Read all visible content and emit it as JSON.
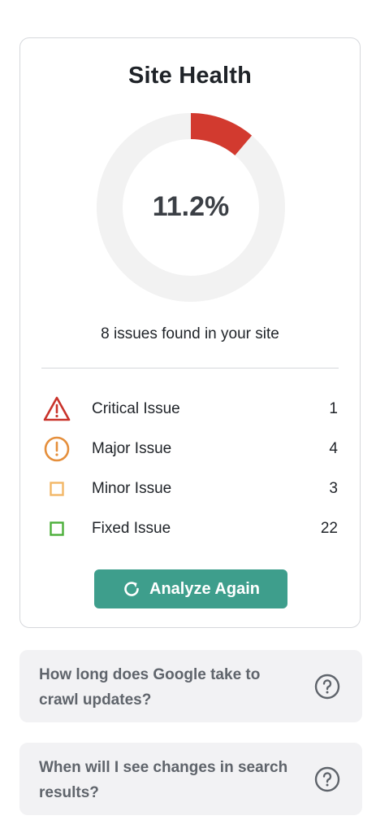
{
  "health": {
    "title": "Site Health",
    "percent_label": "11.2%",
    "percent_value": 11.2,
    "summary": "8 issues found in your site",
    "progress_color": "#d23a2f",
    "track_color": "#f2f2f2"
  },
  "issues": [
    {
      "label": "Critical Issue",
      "count": "1",
      "icon": "warning-triangle-icon",
      "color": "#c9332b"
    },
    {
      "label": "Major Issue",
      "count": "4",
      "icon": "exclamation-circle-icon",
      "color": "#e58f3c"
    },
    {
      "label": "Minor Issue",
      "count": "3",
      "icon": "square-outline-icon",
      "color": "#f2b766"
    },
    {
      "label": "Fixed Issue",
      "count": "22",
      "icon": "square-outline-icon",
      "color": "#4caf3a"
    }
  ],
  "actions": {
    "analyze_label": "Analyze Again",
    "accent_color": "#3e9e8c"
  },
  "faq": [
    {
      "question": "How long does Google take to crawl updates?",
      "icon": "question-circle-icon"
    },
    {
      "question": "When will I see changes in search results?",
      "icon": "question-circle-icon"
    }
  ]
}
